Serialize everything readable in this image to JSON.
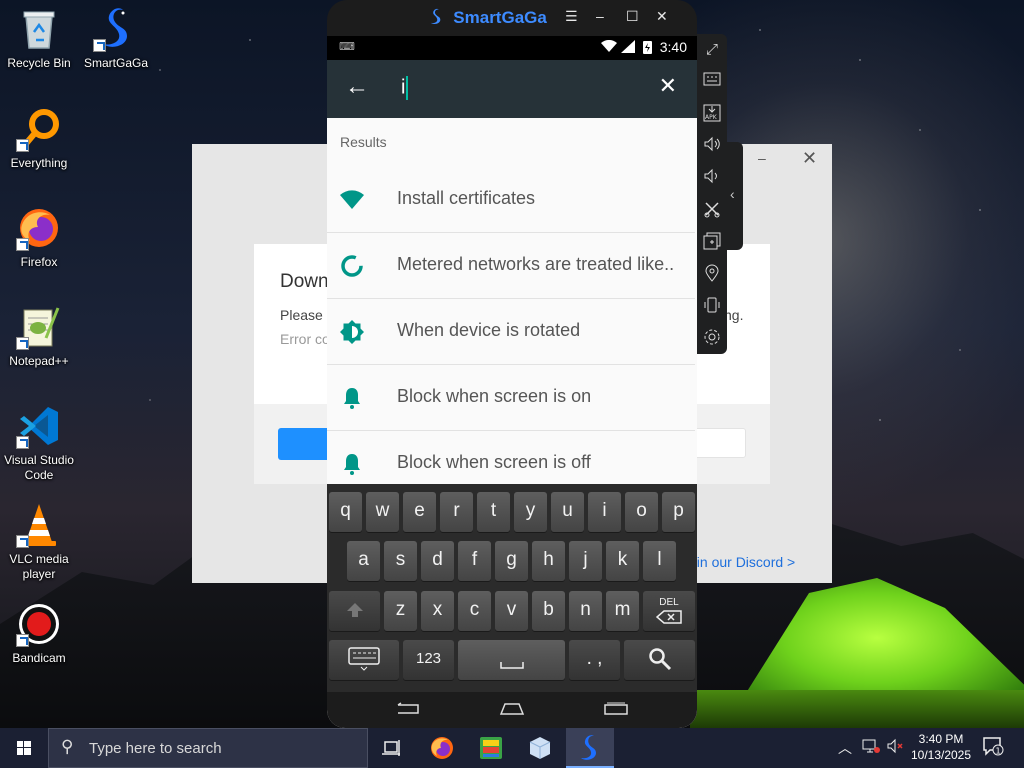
{
  "desktop": {
    "icons": [
      {
        "label": "Recycle Bin",
        "icon": "recycle-bin-icon"
      },
      {
        "label": "SmartGaGa",
        "icon": "smartgaga-swan-icon"
      },
      {
        "label": "Everything",
        "icon": "everything-search-icon"
      },
      {
        "label": "Firefox",
        "icon": "firefox-icon"
      },
      {
        "label": "Notepad++",
        "icon": "notepad-plus-plus-icon"
      },
      {
        "label": "Visual Studio Code",
        "icon": "vscode-icon"
      },
      {
        "label": "VLC media player",
        "icon": "vlc-cone-icon"
      },
      {
        "label": "Bandicam",
        "icon": "bandicam-record-icon"
      }
    ]
  },
  "background_dialog": {
    "title_partial": "Down",
    "text_partial": "Please",
    "text_tail": "ng.",
    "error_partial": "Error co",
    "discord_link": "oin our Discord >",
    "close_glyph": "✕",
    "minimize_glyph": "–"
  },
  "emulator": {
    "app_name": "SmartGaGa",
    "brand_color": "#3d8bff",
    "window_controls": [
      "☰",
      "–",
      "☐",
      "✕"
    ],
    "status_time": "3:40",
    "search_query": "i",
    "results_label": "Results",
    "accent_color": "#009688",
    "results": [
      {
        "text": "Install certificates",
        "icon": "wifi-icon"
      },
      {
        "text": "Metered networks are treated like..",
        "icon": "data-usage-icon"
      },
      {
        "text": "When device is rotated",
        "icon": "brightness-icon"
      },
      {
        "text": "Block when screen is on",
        "icon": "bell-icon"
      },
      {
        "text": "Block when screen is off",
        "icon": "bell-icon"
      }
    ],
    "keyboard": {
      "row1": [
        "q",
        "w",
        "e",
        "r",
        "t",
        "y",
        "u",
        "i",
        "o",
        "p"
      ],
      "row2": [
        "a",
        "s",
        "d",
        "f",
        "g",
        "h",
        "j",
        "k",
        "l"
      ],
      "row3": [
        "z",
        "x",
        "c",
        "v",
        "b",
        "n",
        "m"
      ],
      "delete_label": "DEL",
      "num_label": "123",
      "punct_label": ". ,"
    },
    "side_toolbar": [
      "fullscreen-icon",
      "keyboard-icon",
      "apk-install-icon",
      "volume-up-icon",
      "volume-down-icon",
      "scissors-icon",
      "multi-instance-icon",
      "location-icon",
      "shake-icon",
      "settings-icon"
    ]
  },
  "taskbar": {
    "search_placeholder": "Type here to search",
    "clock_time": "3:40 PM",
    "clock_date": "10/13/2025",
    "notification_count": "1",
    "apps": [
      "task-view-icon",
      "firefox-icon",
      "bluestacks-icon",
      "cube-app-icon",
      "smartgaga-swan-icon"
    ]
  }
}
